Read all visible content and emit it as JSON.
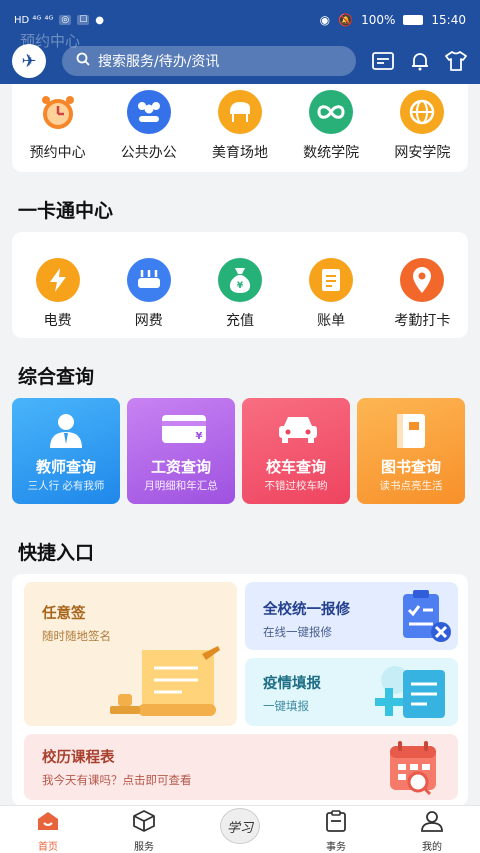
{
  "status_bar": {
    "left": "HD ⁴ᴳ ⁴ᴳ",
    "battery": "100%",
    "time": "15:40"
  },
  "header": {
    "faded_title": "预约中心",
    "search_placeholder": "搜索服务/待办/资讯"
  },
  "top_grid": [
    {
      "label": "预约中心",
      "icon": "alarm-clock-icon"
    },
    {
      "label": "公共办公",
      "icon": "people-icon"
    },
    {
      "label": "美育场地",
      "icon": "piano-icon"
    },
    {
      "label": "数统学院",
      "icon": "infinity-icon"
    },
    {
      "label": "网安学院",
      "icon": "globe-icon"
    }
  ],
  "ykt": {
    "title": "一卡通中心",
    "items": [
      {
        "label": "电费",
        "icon": "lightning-icon",
        "color": "#f7a21b"
      },
      {
        "label": "网费",
        "icon": "router-icon",
        "color": "#3d7ff0"
      },
      {
        "label": "充值",
        "icon": "money-bag-icon",
        "color": "#25b178"
      },
      {
        "label": "账单",
        "icon": "bill-icon",
        "color": "#f7a21b"
      },
      {
        "label": "考勤打卡",
        "icon": "location-pin-icon",
        "color": "#f2682b"
      }
    ]
  },
  "query": {
    "title": "综合查询",
    "tiles": [
      {
        "title": "教师查询",
        "sub": "三人行 必有我师",
        "color": "#2f9bf0",
        "icon": "teacher-icon"
      },
      {
        "title": "工资查询",
        "sub": "月明细和年汇总",
        "color": "#b064e6",
        "icon": "salary-card-icon"
      },
      {
        "title": "校车查询",
        "sub": "不错过校车哟",
        "color": "#f2556a",
        "icon": "car-icon"
      },
      {
        "title": "图书查询",
        "sub": "读书点亮生活",
        "color": "#fba23a",
        "icon": "book-icon"
      }
    ]
  },
  "quick": {
    "title": "快捷入口",
    "sign": {
      "title": "任意签",
      "sub": "随时随地签名"
    },
    "repair": {
      "title": "全校统一报修",
      "sub": "在线一键报修"
    },
    "epidemic": {
      "title": "疫情填报",
      "sub": "一键填报"
    },
    "schedule": {
      "title": "校历课程表",
      "sub": "我今天有课吗？点击即可查看"
    }
  },
  "bottom_nav": [
    {
      "label": "首页",
      "icon": "home-icon",
      "active": true
    },
    {
      "label": "服务",
      "icon": "box-icon",
      "active": false
    },
    {
      "label": "学习",
      "icon": "study-icon",
      "active": false
    },
    {
      "label": "事务",
      "icon": "clipboard-icon",
      "active": false
    },
    {
      "label": "我的",
      "icon": "user-icon",
      "active": false
    }
  ]
}
